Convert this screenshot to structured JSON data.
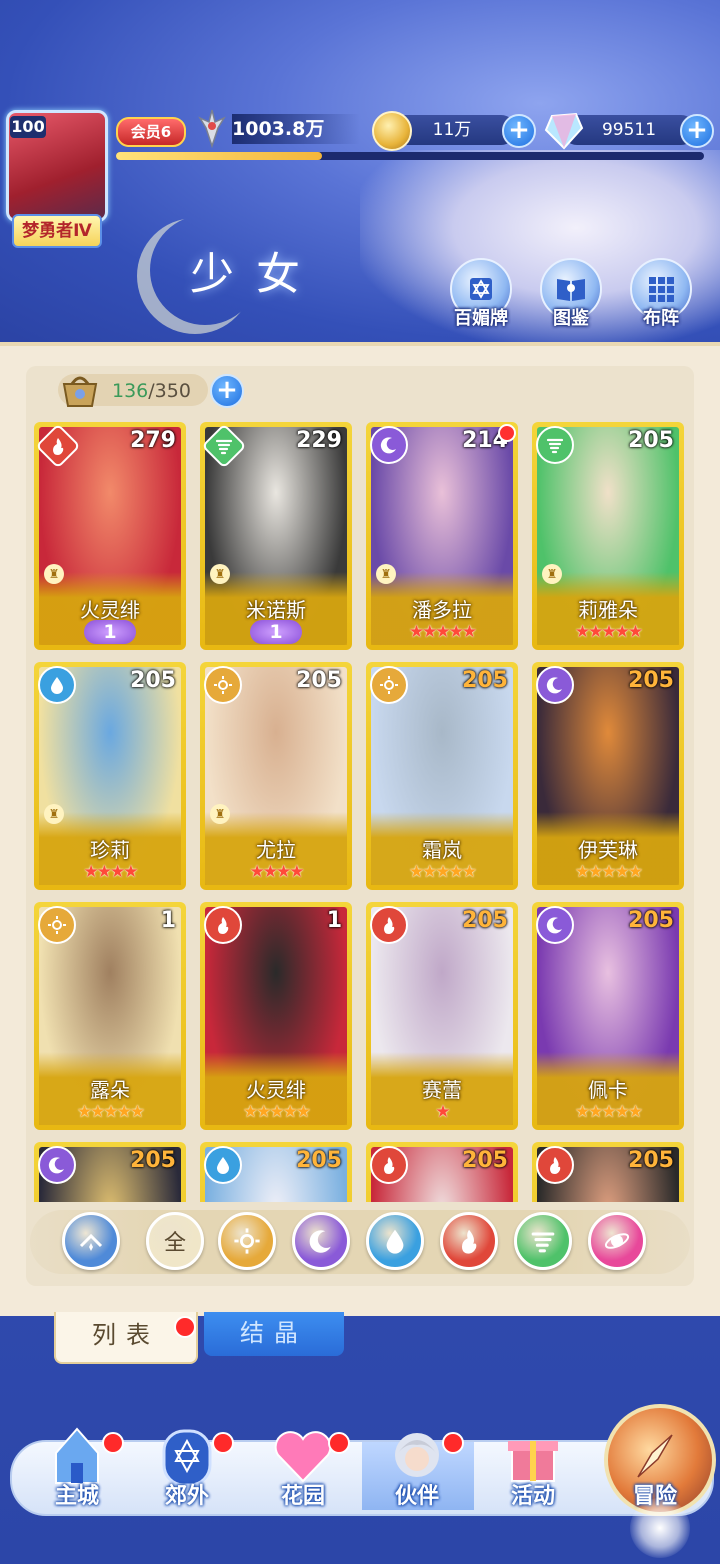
{
  "header": {
    "avatar_level": "100",
    "rank_badge": "梦勇者Ⅳ",
    "vip": "会员6",
    "power": "1003.8万",
    "xp_progress": 0.35,
    "gold": "11万",
    "gems": "99511",
    "page_title": "少女",
    "buttons": [
      {
        "label": "百媚牌",
        "icon": "hexagram-card-icon"
      },
      {
        "label": "图鉴",
        "icon": "book-icon"
      },
      {
        "label": "布阵",
        "icon": "grid-formation-icon"
      }
    ]
  },
  "collection": {
    "current": "136",
    "max": "/350"
  },
  "colors": {
    "fire": "#e0473a",
    "wind": "#4fc26a",
    "moon": "#8a5ad8",
    "water": "#3aa0e0",
    "sun": "#e6a93a",
    "star": "#ff4a3a",
    "card_gold": "#f0c520"
  },
  "cards": [
    {
      "name": "火灵绯",
      "level": "279",
      "element": "fire",
      "diamond": true,
      "awaken": "1",
      "stars": 0,
      "pawn": true,
      "art": [
        "#c8283a",
        "#f28a6a"
      ]
    },
    {
      "name": "米诺斯",
      "level": "229",
      "element": "wind",
      "diamond": true,
      "awaken": "1",
      "stars": 0,
      "pawn": true,
      "art": [
        "#3a3a3a",
        "#e9e6e0"
      ]
    },
    {
      "name": "潘多拉",
      "level": "214",
      "element": "moon",
      "diamond": false,
      "awaken": "",
      "stars": 5,
      "pawn": true,
      "dot": true,
      "art": [
        "#6a4aa8",
        "#e9c0d8"
      ]
    },
    {
      "name": "莉雅朵",
      "level": "205",
      "element": "wind",
      "diamond": false,
      "awaken": "",
      "stars": 5,
      "pawn": true,
      "art": [
        "#4fc26a",
        "#f0e0c8"
      ]
    },
    {
      "name": "珍莉",
      "level": "205",
      "element": "water",
      "diamond": false,
      "awaken": "",
      "stars": 4,
      "pawn": true,
      "art": [
        "#f0e0a0",
        "#6aa8e0"
      ]
    },
    {
      "name": "尤拉",
      "level": "205",
      "element": "sun",
      "diamond": false,
      "awaken": "",
      "stars": 4,
      "pawn": true,
      "art": [
        "#f2e0c8",
        "#d8b090"
      ]
    },
    {
      "name": "霜岚",
      "level": "205",
      "element": "sun",
      "diamond": false,
      "awaken": "",
      "stars": 5,
      "gold": true,
      "orange": true,
      "art": [
        "#c8d8ee",
        "#a8b8c8"
      ]
    },
    {
      "name": "伊芙琳",
      "level": "205",
      "element": "moon",
      "diamond": false,
      "awaken": "",
      "stars": 5,
      "gold": true,
      "orange": true,
      "art": [
        "#3a2a3a",
        "#e08a3a"
      ]
    },
    {
      "name": "露朵",
      "level": "1",
      "element": "sun",
      "diamond": false,
      "awaken": "",
      "stars": 5,
      "gold": true,
      "art": [
        "#f0e0b0",
        "#a08060"
      ]
    },
    {
      "name": "火灵绯",
      "level": "1",
      "element": "fire",
      "diamond": false,
      "awaken": "",
      "stars": 5,
      "gold": true,
      "art": [
        "#c8283a",
        "#2a2a2a"
      ]
    },
    {
      "name": "赛蕾",
      "level": "205",
      "element": "fire",
      "diamond": false,
      "awaken": "",
      "stars": 1,
      "orange": true,
      "art": [
        "#ece8ee",
        "#c0a8c8"
      ]
    },
    {
      "name": "佩卡",
      "level": "205",
      "element": "moon",
      "diamond": false,
      "awaken": "",
      "stars": 5,
      "gold": true,
      "orange": true,
      "art": [
        "#7a3ab0",
        "#e8c0e0"
      ]
    },
    {
      "name": "",
      "level": "205",
      "element": "moon",
      "orange": true,
      "art": [
        "#2a2a3a",
        "#e0c070"
      ]
    },
    {
      "name": "",
      "level": "205",
      "element": "water",
      "orange": true,
      "art": [
        "#7ab0e0",
        "#f0f0f8"
      ]
    },
    {
      "name": "",
      "level": "205",
      "element": "fire",
      "orange": true,
      "art": [
        "#c8283a",
        "#f0e0e0"
      ]
    },
    {
      "name": "",
      "level": "205",
      "element": "fire",
      "orange": true,
      "art": [
        "#2a2a2a",
        "#e0a080"
      ]
    }
  ],
  "filters": [
    {
      "name": "sort-toggle",
      "label": "",
      "bg": "#4f8ad8",
      "icon": "chevron-up-icon"
    },
    {
      "name": "filter-all",
      "label": "全",
      "bg": "#f0e6c8",
      "icon": "all-icon"
    },
    {
      "name": "filter-sun",
      "label": "",
      "bg": "#e6a93a",
      "icon": "sun-icon"
    },
    {
      "name": "filter-moon",
      "label": "",
      "bg": "#8a5ad8",
      "icon": "moon-icon"
    },
    {
      "name": "filter-water",
      "label": "",
      "bg": "#3aa0e0",
      "icon": "water-drop-icon"
    },
    {
      "name": "filter-fire",
      "label": "",
      "bg": "#e0473a",
      "icon": "flame-icon"
    },
    {
      "name": "filter-wind",
      "label": "",
      "bg": "#4fc26a",
      "icon": "tornado-icon"
    },
    {
      "name": "filter-star",
      "label": "",
      "bg": "#e8489a",
      "icon": "orbit-icon"
    }
  ],
  "tabs": {
    "list": "列表",
    "crystal": "结晶"
  },
  "nav": [
    {
      "label": "主城",
      "icon": "castle-icon",
      "dot": true
    },
    {
      "label": "郊外",
      "icon": "hexagram-portal-icon",
      "dot": true
    },
    {
      "label": "花园",
      "icon": "heart-icon",
      "dot": true
    },
    {
      "label": "伙伴",
      "icon": "partner-portrait-icon",
      "dot": true
    },
    {
      "label": "活动",
      "icon": "gift-box-icon",
      "dot": false
    },
    {
      "label": "冒险",
      "icon": "compass-icon",
      "dot": false
    }
  ]
}
